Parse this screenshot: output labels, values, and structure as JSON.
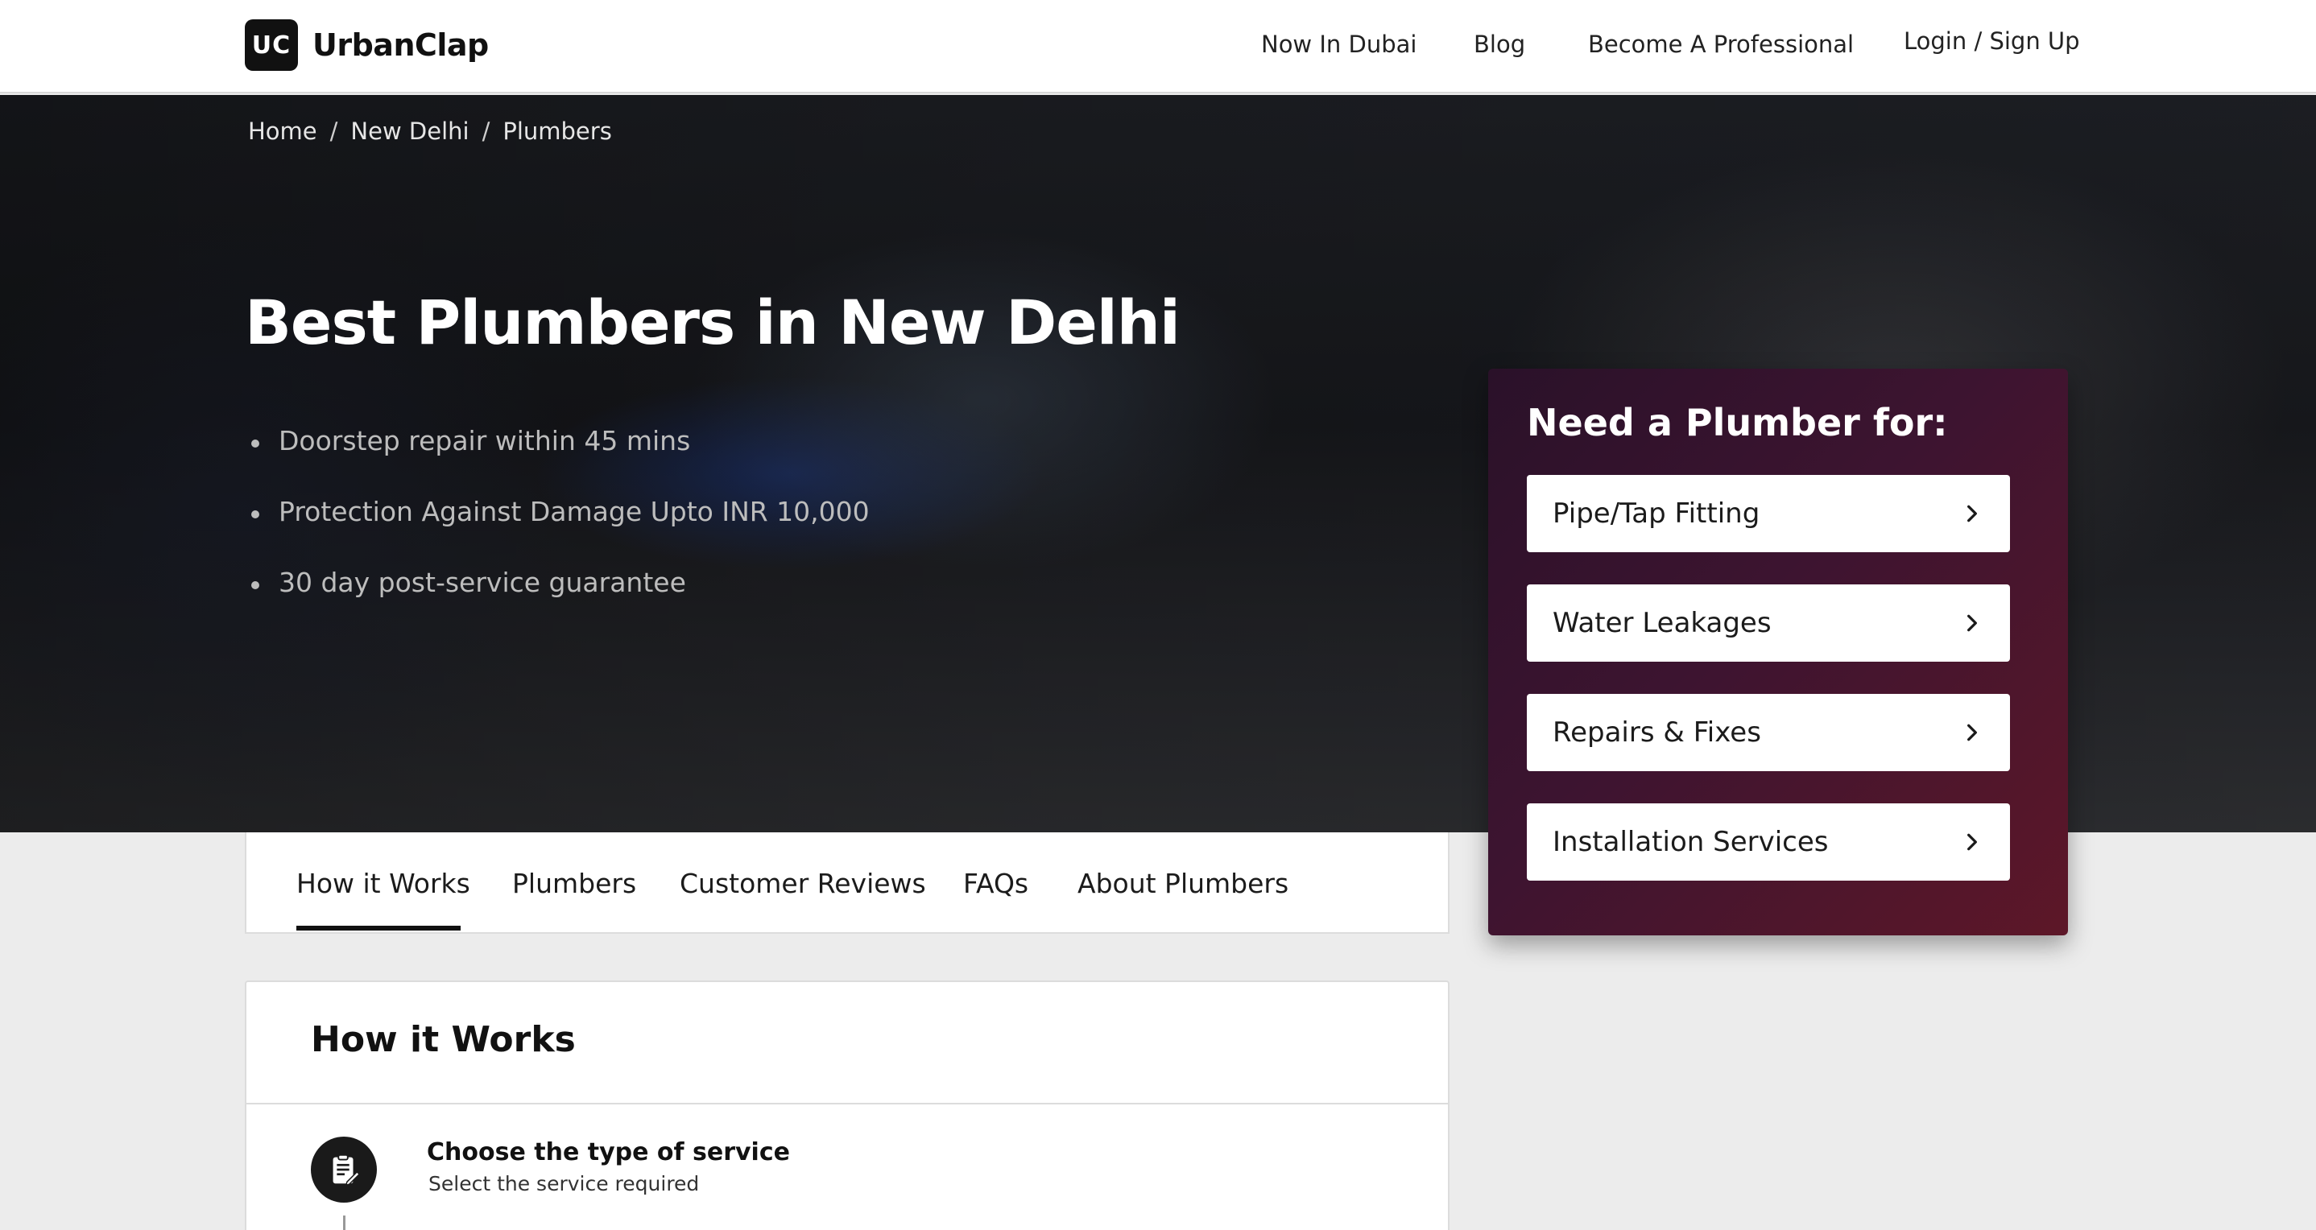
{
  "header": {
    "logo_badge": "UC",
    "logo_text": "UrbanClap",
    "nav": [
      "Now In Dubai",
      "Blog",
      "Become A Professional",
      "Login / Sign Up"
    ]
  },
  "breadcrumb": [
    "Home",
    "/",
    "New Delhi",
    "/",
    "Plumbers"
  ],
  "hero": {
    "title": "Best Plumbers in New Delhi",
    "bullets": [
      "Doorstep repair within 45 mins",
      "Protection Against Damage Upto INR 10,000",
      "30 day post-service guarantee"
    ]
  },
  "card": {
    "title": "Need a Plumber for:",
    "services": [
      "Pipe/Tap Fitting",
      "Water Leakages",
      "Repairs & Fixes",
      "Installation Services"
    ],
    "service_icon": "chevron-right-icon"
  },
  "tabs": {
    "items": [
      "How it Works",
      "Plumbers",
      "Customer Reviews",
      "FAQs",
      "About Plumbers"
    ],
    "active": "How it Works"
  },
  "how_it_works": {
    "title": "How it Works",
    "steps": [
      {
        "title": "Choose the type of service",
        "subtitle": "Select the service required",
        "icon": "clipboard-icon"
      }
    ]
  },
  "colors": {
    "card_gradient_start": "#2a1129",
    "card_gradient_end": "#5d1728",
    "header_bg": "#ffffff",
    "page_bg": "#ececec"
  }
}
